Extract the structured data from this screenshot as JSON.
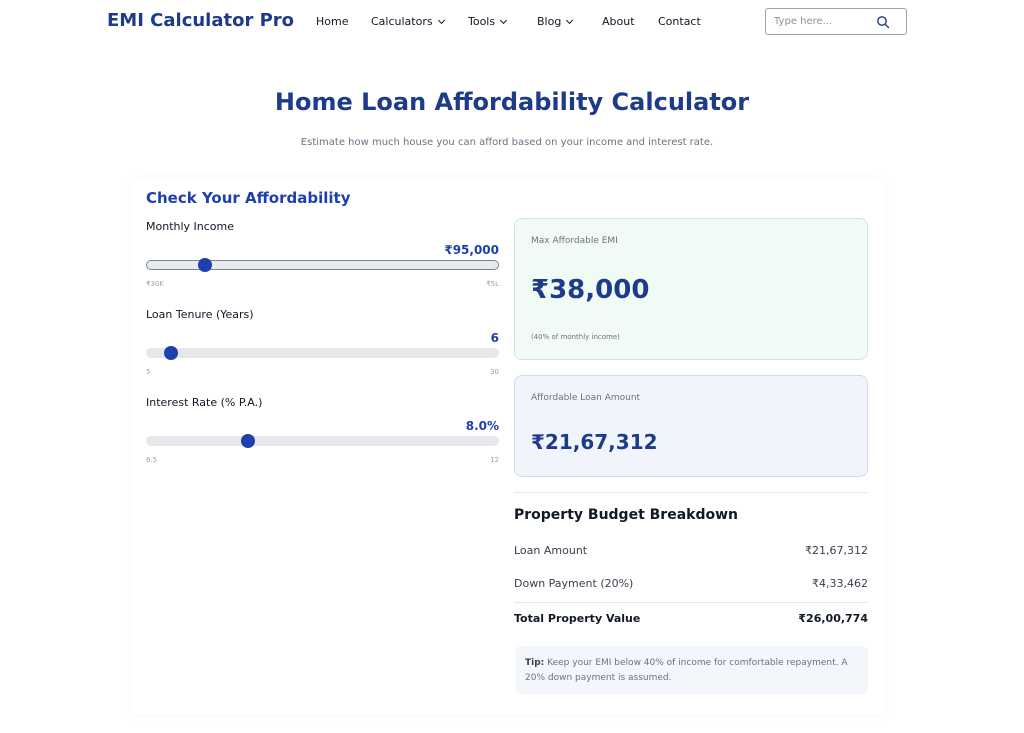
{
  "header": {
    "brand": "EMI Calculator Pro",
    "nav": [
      {
        "label": "Home",
        "dropdown": false
      },
      {
        "label": "Calculators",
        "dropdown": true
      },
      {
        "label": "Tools",
        "dropdown": true
      },
      {
        "label": "Blog",
        "dropdown": true
      },
      {
        "label": "About",
        "dropdown": false
      },
      {
        "label": "Contact",
        "dropdown": false
      }
    ],
    "search": {
      "placeholder": "Type here...",
      "icon": "search-icon"
    }
  },
  "page": {
    "title": "Home Loan Affordability Calculator",
    "subtitle": "Estimate how much house you can afford based on your income and interest rate."
  },
  "form": {
    "title": "Check Your Affordability",
    "income": {
      "label": "Monthly Income",
      "value": "₹95,000",
      "min": "₹30K",
      "max": "₹5L",
      "fraction": 0.165
    },
    "tenure": {
      "label": "Loan Tenure (Years)",
      "value": "6",
      "min": "5",
      "max": "30",
      "fraction": 0.07
    },
    "rate": {
      "label": "Interest Rate (% P.A.)",
      "value": "8.0%",
      "min": "6.5",
      "max": "12",
      "fraction": 0.29
    }
  },
  "results": {
    "emi": {
      "label": "Max Affordable EMI",
      "value": "₹38,000",
      "note": "(40% of monthly income)"
    },
    "loan": {
      "label": "Affordable Loan Amount",
      "value": "₹21,67,312"
    }
  },
  "breakdown": {
    "title": "Property Budget Breakdown",
    "rows": [
      {
        "label": "Loan Amount",
        "value": "₹21,67,312"
      },
      {
        "label": "Down Payment (20%)",
        "value": "₹4,33,462"
      }
    ],
    "total": {
      "label": "Total Property Value",
      "value": "₹26,00,774"
    }
  },
  "tip": {
    "prefix": "Tip:",
    "text": "Keep your EMI below 40% of income for comfortable repayment. A 20% down payment is assumed."
  },
  "colors": {
    "brand": "#1e3a8a",
    "accent": "#1e40af",
    "emi_bg": "#f1fbf6",
    "loan_bg": "#f1f5fb"
  }
}
